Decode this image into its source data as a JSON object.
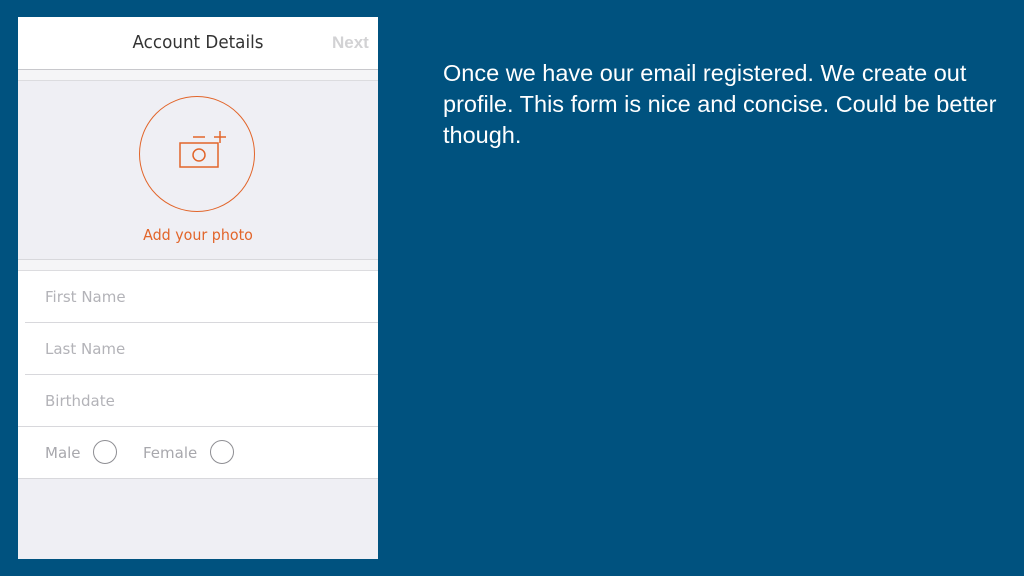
{
  "slide": {
    "caption": "Once we have our email registered. We create out profile. This form is nice and concise. Could be better though.",
    "background_color": "#00527f"
  },
  "app": {
    "navbar": {
      "title": "Account Details",
      "next_label": "Next"
    },
    "photo": {
      "icon": "camera-add-icon",
      "label": "Add your photo",
      "accent_color": "#e2652a"
    },
    "form": {
      "first_name": {
        "value": "",
        "placeholder": "First Name"
      },
      "last_name": {
        "value": "",
        "placeholder": "Last Name"
      },
      "birthdate": {
        "value": "",
        "placeholder": "Birthdate"
      },
      "gender": {
        "options": [
          {
            "label": "Male",
            "selected": false
          },
          {
            "label": "Female",
            "selected": false
          }
        ]
      }
    }
  }
}
